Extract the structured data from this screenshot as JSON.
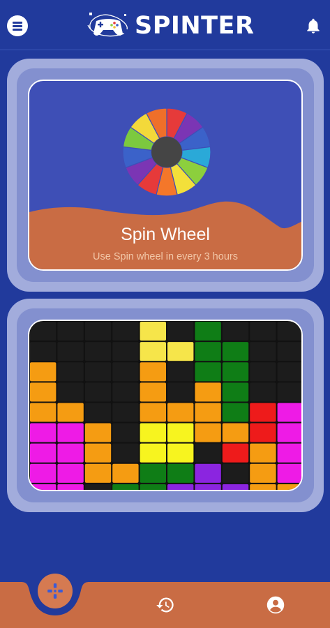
{
  "app": {
    "title": "SPINTER"
  },
  "header": {
    "menu_icon": "menu-icon",
    "logo_icon": "gamepad-logo-icon",
    "notification_icon": "bell-icon"
  },
  "spin_card": {
    "title": "Spin Wheel",
    "subtitle": "Use Spin wheel in every 3 hours",
    "wheel_colors": [
      "#e63a3a",
      "#7b35b4",
      "#3b62c9",
      "#2aa9d8",
      "#8ccf3d",
      "#f3e03a",
      "#f4772a",
      "#e63a3a",
      "#7b35b4",
      "#3b62c9",
      "#7cc93f",
      "#f3d93a",
      "#ef6f2a"
    ]
  },
  "puzzle_card": {
    "grid": [
      [
        "#1c1c1c",
        "#1c1c1c",
        "#1c1c1c",
        "#1c1c1c",
        "#f6e54a",
        "#1c1c1c",
        "#0f7d16",
        "#1c1c1c",
        "#1c1c1c",
        "#1c1c1c"
      ],
      [
        "#1c1c1c",
        "#1c1c1c",
        "#1c1c1c",
        "#1c1c1c",
        "#f6e54a",
        "#f6e54a",
        "#0f7d16",
        "#0f7d16",
        "#1c1c1c",
        "#1c1c1c"
      ],
      [
        "#f59c12",
        "#1c1c1c",
        "#1c1c1c",
        "#1c1c1c",
        "#f59c12",
        "#1c1c1c",
        "#0f7d16",
        "#0f7d16",
        "#1c1c1c",
        "#1c1c1c"
      ],
      [
        "#f59c12",
        "#1c1c1c",
        "#1c1c1c",
        "#1c1c1c",
        "#f59c12",
        "#1c1c1c",
        "#f59c12",
        "#0f7d16",
        "#1c1c1c",
        "#1c1c1c"
      ],
      [
        "#f59c12",
        "#f59c12",
        "#1c1c1c",
        "#1c1c1c",
        "#f59c12",
        "#f59c12",
        "#f59c12",
        "#0f7d16",
        "#ee1b1b",
        "#ee1be6"
      ],
      [
        "#ee1be6",
        "#ee1be6",
        "#f59c12",
        "#1c1c1c",
        "#f7f41f",
        "#f7f41f",
        "#f59c12",
        "#f59c12",
        "#ee1b1b",
        "#ee1be6"
      ],
      [
        "#ee1be6",
        "#ee1be6",
        "#f59c12",
        "#1c1c1c",
        "#f7f41f",
        "#f7f41f",
        "#1c1c1c",
        "#ee1b1b",
        "#f59c12",
        "#ee1be6"
      ],
      [
        "#ee1be6",
        "#ee1be6",
        "#f59c12",
        "#f59c12",
        "#0f7d16",
        "#0f7d16",
        "#8b25e0",
        "#1c1c1c",
        "#f59c12",
        "#ee1be6"
      ],
      [
        "#ee1be6",
        "#ee1be6",
        "#1c1c1c",
        "#0f7d16",
        "#0f7d16",
        "#8b25e0",
        "#8b25e0",
        "#8b25e0",
        "#f59c12",
        "#f59c12"
      ]
    ]
  },
  "bottom_nav": {
    "items": [
      {
        "name": "games",
        "icon": "gamepad-icon",
        "active": true
      },
      {
        "name": "history",
        "icon": "history-icon",
        "active": false
      },
      {
        "name": "profile",
        "icon": "account-icon",
        "active": false
      }
    ]
  },
  "colors": {
    "background": "#213a9c",
    "card_border": "#a2acdc",
    "spin_background": "#3e4fb6",
    "hills": "#c96c44",
    "nav": "#c96c44"
  }
}
